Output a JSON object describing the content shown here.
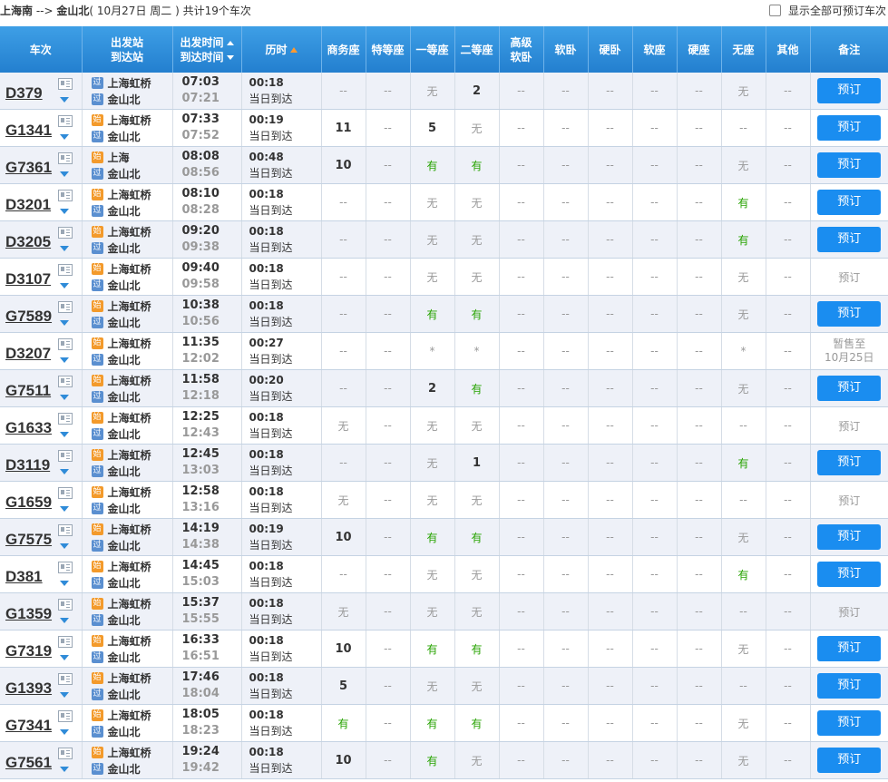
{
  "header": {
    "route_from": "上海南",
    "route_sep": "-->",
    "route_to": "金山北",
    "date_text": "( 10月27日  周二 )",
    "summary": "共计19个车次",
    "show_all_label": "显示全部可预订车次"
  },
  "columns": {
    "train": "车次",
    "station_top": "出发站",
    "station_bottom": "到达站",
    "time_top": "出发时间",
    "time_bottom": "到达时间",
    "duration": "历时",
    "business": "商务座",
    "special": "特等座",
    "first": "一等座",
    "second": "二等座",
    "adv_top": "高级",
    "adv_bottom": "软卧",
    "soft_sleeper": "软卧",
    "hard_sleeper": "硬卧",
    "soft_seat": "软座",
    "hard_seat": "硬座",
    "no_seat": "无座",
    "other": "其他",
    "remark": "备注"
  },
  "badges": {
    "start": "始",
    "pass": "过"
  },
  "rows": [
    {
      "train": "D379",
      "dep_station": "上海虹桥",
      "arr_station": "金山北",
      "dep_badge": "过",
      "arr_badge": "过",
      "dep": "07:03",
      "arr": "07:21",
      "dur": "00:18",
      "arrive_day": "当日到达",
      "seats": [
        "--",
        "--",
        "无",
        "2",
        "--",
        "--",
        "--",
        "--",
        "--",
        "无",
        "--"
      ],
      "action": "预订",
      "action_type": "button"
    },
    {
      "train": "G1341",
      "dep_station": "上海虹桥",
      "arr_station": "金山北",
      "dep_badge": "始",
      "arr_badge": "过",
      "dep": "07:33",
      "arr": "07:52",
      "dur": "00:19",
      "arrive_day": "当日到达",
      "seats": [
        "11",
        "--",
        "5",
        "无",
        "--",
        "--",
        "--",
        "--",
        "--",
        "--",
        "--"
      ],
      "action": "预订",
      "action_type": "button"
    },
    {
      "train": "G7361",
      "dep_station": "上海",
      "arr_station": "金山北",
      "dep_badge": "始",
      "arr_badge": "过",
      "dep": "08:08",
      "arr": "08:56",
      "dur": "00:48",
      "arrive_day": "当日到达",
      "seats": [
        "10",
        "--",
        "有",
        "有",
        "--",
        "--",
        "--",
        "--",
        "--",
        "无",
        "--"
      ],
      "action": "预订",
      "action_type": "button"
    },
    {
      "train": "D3201",
      "dep_station": "上海虹桥",
      "arr_station": "金山北",
      "dep_badge": "始",
      "arr_badge": "过",
      "dep": "08:10",
      "arr": "08:28",
      "dur": "00:18",
      "arrive_day": "当日到达",
      "seats": [
        "--",
        "--",
        "无",
        "无",
        "--",
        "--",
        "--",
        "--",
        "--",
        "有",
        "--"
      ],
      "action": "预订",
      "action_type": "button"
    },
    {
      "train": "D3205",
      "dep_station": "上海虹桥",
      "arr_station": "金山北",
      "dep_badge": "始",
      "arr_badge": "过",
      "dep": "09:20",
      "arr": "09:38",
      "dur": "00:18",
      "arrive_day": "当日到达",
      "seats": [
        "--",
        "--",
        "无",
        "无",
        "--",
        "--",
        "--",
        "--",
        "--",
        "有",
        "--"
      ],
      "action": "预订",
      "action_type": "button"
    },
    {
      "train": "D3107",
      "dep_station": "上海虹桥",
      "arr_station": "金山北",
      "dep_badge": "始",
      "arr_badge": "过",
      "dep": "09:40",
      "arr": "09:58",
      "dur": "00:18",
      "arrive_day": "当日到达",
      "seats": [
        "--",
        "--",
        "无",
        "无",
        "--",
        "--",
        "--",
        "--",
        "--",
        "无",
        "--"
      ],
      "action": "预订",
      "action_type": "disabled"
    },
    {
      "train": "G7589",
      "dep_station": "上海虹桥",
      "arr_station": "金山北",
      "dep_badge": "始",
      "arr_badge": "过",
      "dep": "10:38",
      "arr": "10:56",
      "dur": "00:18",
      "arrive_day": "当日到达",
      "seats": [
        "--",
        "--",
        "有",
        "有",
        "--",
        "--",
        "--",
        "--",
        "--",
        "无",
        "--"
      ],
      "action": "预订",
      "action_type": "button"
    },
    {
      "train": "D3207",
      "dep_station": "上海虹桥",
      "arr_station": "金山北",
      "dep_badge": "始",
      "arr_badge": "过",
      "dep": "11:35",
      "arr": "12:02",
      "dur": "00:27",
      "arrive_day": "当日到达",
      "seats": [
        "--",
        "--",
        "*",
        "*",
        "--",
        "--",
        "--",
        "--",
        "--",
        "*",
        "--"
      ],
      "action": "暂售至",
      "action2": "10月25日",
      "action_type": "note"
    },
    {
      "train": "G7511",
      "dep_station": "上海虹桥",
      "arr_station": "金山北",
      "dep_badge": "始",
      "arr_badge": "过",
      "dep": "11:58",
      "arr": "12:18",
      "dur": "00:20",
      "arrive_day": "当日到达",
      "seats": [
        "--",
        "--",
        "2",
        "有",
        "--",
        "--",
        "--",
        "--",
        "--",
        "无",
        "--"
      ],
      "action": "预订",
      "action_type": "button"
    },
    {
      "train": "G1633",
      "dep_station": "上海虹桥",
      "arr_station": "金山北",
      "dep_badge": "始",
      "arr_badge": "过",
      "dep": "12:25",
      "arr": "12:43",
      "dur": "00:18",
      "arrive_day": "当日到达",
      "seats": [
        "无",
        "--",
        "无",
        "无",
        "--",
        "--",
        "--",
        "--",
        "--",
        "--",
        "--"
      ],
      "action": "预订",
      "action_type": "disabled"
    },
    {
      "train": "D3119",
      "dep_station": "上海虹桥",
      "arr_station": "金山北",
      "dep_badge": "始",
      "arr_badge": "过",
      "dep": "12:45",
      "arr": "13:03",
      "dur": "00:18",
      "arrive_day": "当日到达",
      "seats": [
        "--",
        "--",
        "无",
        "1",
        "--",
        "--",
        "--",
        "--",
        "--",
        "有",
        "--"
      ],
      "action": "预订",
      "action_type": "button"
    },
    {
      "train": "G1659",
      "dep_station": "上海虹桥",
      "arr_station": "金山北",
      "dep_badge": "始",
      "arr_badge": "过",
      "dep": "12:58",
      "arr": "13:16",
      "dur": "00:18",
      "arrive_day": "当日到达",
      "seats": [
        "无",
        "--",
        "无",
        "无",
        "--",
        "--",
        "--",
        "--",
        "--",
        "--",
        "--"
      ],
      "action": "预订",
      "action_type": "disabled"
    },
    {
      "train": "G7575",
      "dep_station": "上海虹桥",
      "arr_station": "金山北",
      "dep_badge": "始",
      "arr_badge": "过",
      "dep": "14:19",
      "arr": "14:38",
      "dur": "00:19",
      "arrive_day": "当日到达",
      "seats": [
        "10",
        "--",
        "有",
        "有",
        "--",
        "--",
        "--",
        "--",
        "--",
        "无",
        "--"
      ],
      "action": "预订",
      "action_type": "button"
    },
    {
      "train": "D381",
      "dep_station": "上海虹桥",
      "arr_station": "金山北",
      "dep_badge": "始",
      "arr_badge": "过",
      "dep": "14:45",
      "arr": "15:03",
      "dur": "00:18",
      "arrive_day": "当日到达",
      "seats": [
        "--",
        "--",
        "无",
        "无",
        "--",
        "--",
        "--",
        "--",
        "--",
        "有",
        "--"
      ],
      "action": "预订",
      "action_type": "button"
    },
    {
      "train": "G1359",
      "dep_station": "上海虹桥",
      "arr_station": "金山北",
      "dep_badge": "始",
      "arr_badge": "过",
      "dep": "15:37",
      "arr": "15:55",
      "dur": "00:18",
      "arrive_day": "当日到达",
      "seats": [
        "无",
        "--",
        "无",
        "无",
        "--",
        "--",
        "--",
        "--",
        "--",
        "--",
        "--"
      ],
      "action": "预订",
      "action_type": "disabled"
    },
    {
      "train": "G7319",
      "dep_station": "上海虹桥",
      "arr_station": "金山北",
      "dep_badge": "始",
      "arr_badge": "过",
      "dep": "16:33",
      "arr": "16:51",
      "dur": "00:18",
      "arrive_day": "当日到达",
      "seats": [
        "10",
        "--",
        "有",
        "有",
        "--",
        "--",
        "--",
        "--",
        "--",
        "无",
        "--"
      ],
      "action": "预订",
      "action_type": "button"
    },
    {
      "train": "G1393",
      "dep_station": "上海虹桥",
      "arr_station": "金山北",
      "dep_badge": "始",
      "arr_badge": "过",
      "dep": "17:46",
      "arr": "18:04",
      "dur": "00:18",
      "arrive_day": "当日到达",
      "seats": [
        "5",
        "--",
        "无",
        "无",
        "--",
        "--",
        "--",
        "--",
        "--",
        "--",
        "--"
      ],
      "action": "预订",
      "action_type": "button"
    },
    {
      "train": "G7341",
      "dep_station": "上海虹桥",
      "arr_station": "金山北",
      "dep_badge": "始",
      "arr_badge": "过",
      "dep": "18:05",
      "arr": "18:23",
      "dur": "00:18",
      "arrive_day": "当日到达",
      "seats": [
        "有",
        "--",
        "有",
        "有",
        "--",
        "--",
        "--",
        "--",
        "--",
        "无",
        "--"
      ],
      "action": "预订",
      "action_type": "button"
    },
    {
      "train": "G7561",
      "dep_station": "上海虹桥",
      "arr_station": "金山北",
      "dep_badge": "始",
      "arr_badge": "过",
      "dep": "19:24",
      "arr": "19:42",
      "dur": "00:18",
      "arrive_day": "当日到达",
      "seats": [
        "10",
        "--",
        "有",
        "无",
        "--",
        "--",
        "--",
        "--",
        "--",
        "无",
        "--"
      ],
      "action": "预订",
      "action_type": "button"
    }
  ],
  "colors": {
    "header_blue": "#2f8bd8",
    "button_blue": "#1a8df0",
    "available_green": "#26a300",
    "start_badge": "#f39a2b",
    "pass_badge": "#5a8fd0"
  }
}
